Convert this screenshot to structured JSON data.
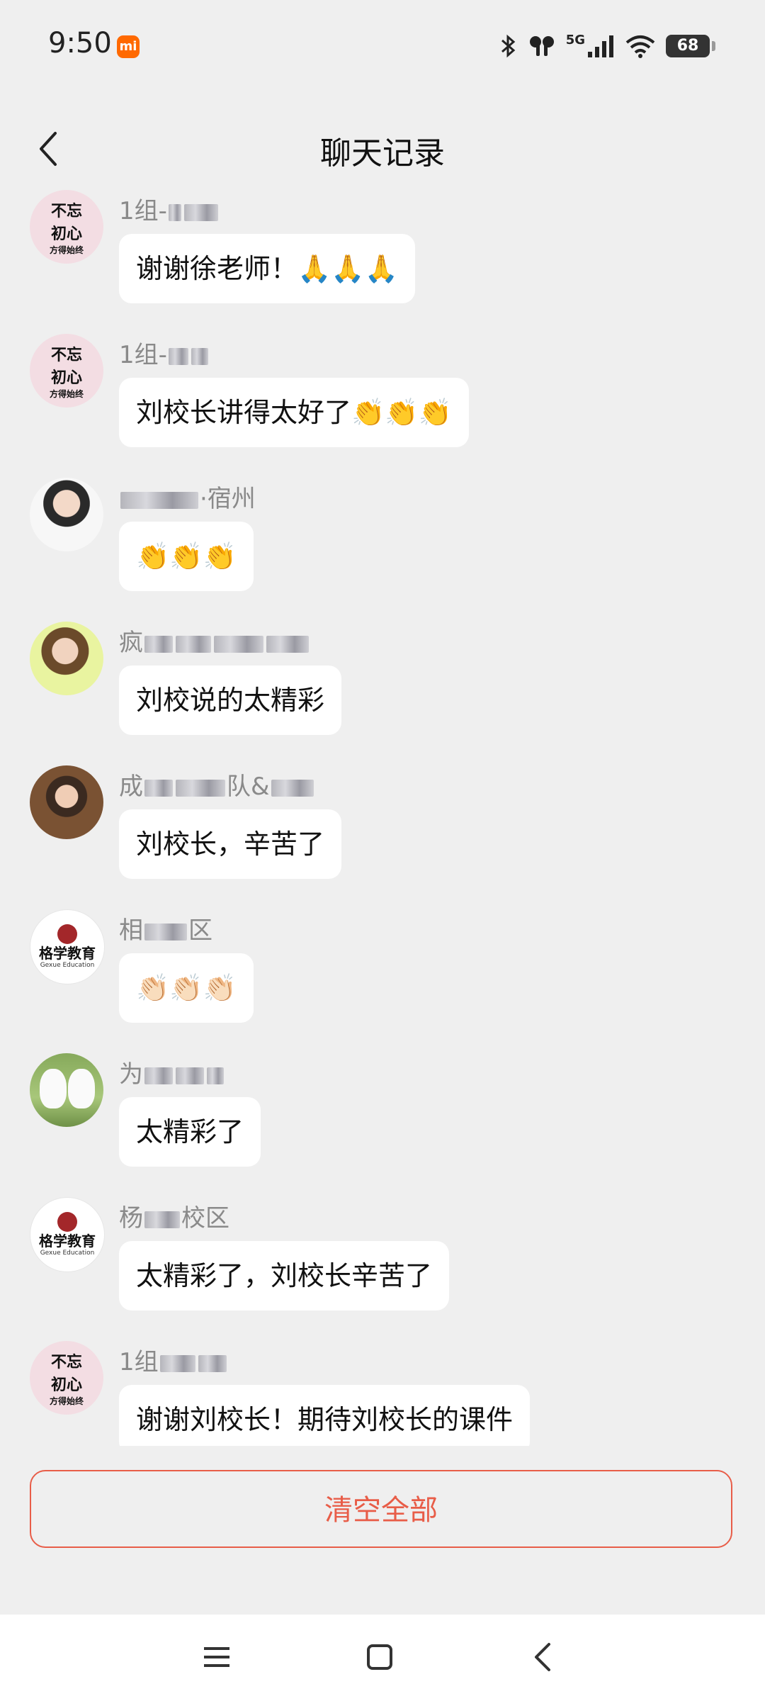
{
  "status_bar": {
    "time": "9:50",
    "app_badge": "mi",
    "network": "5G",
    "battery": "68",
    "icons": [
      "bluetooth-icon",
      "earbuds-icon",
      "signal-icon",
      "wifi-icon",
      "battery-icon"
    ]
  },
  "header": {
    "title": "聊天记录",
    "back_icon": "chevron-left-icon"
  },
  "messages": [
    {
      "sender_prefix": "1组-",
      "sender_suffix": "",
      "text": "谢谢徐老师！🙏🙏🙏"
    },
    {
      "sender_prefix": "1组-",
      "sender_suffix": "",
      "text": "刘校长讲得太好了👏👏👏"
    },
    {
      "sender_prefix": "",
      "sender_suffix": "·宿州",
      "text": "👏👏👏"
    },
    {
      "sender_prefix": "疯",
      "sender_suffix": "",
      "text": "刘校说的太精彩"
    },
    {
      "sender_prefix": "成",
      "sender_suffix": "队&",
      "text": "刘校长，辛苦了"
    },
    {
      "sender_prefix": "相",
      "sender_suffix": "区",
      "text": "👏🏻👏🏻👏🏻"
    },
    {
      "sender_prefix": "为",
      "sender_suffix": "",
      "text": "太精彩了"
    },
    {
      "sender_prefix": "杨",
      "sender_suffix": "校区",
      "text": "太精彩了，刘校长辛苦了"
    },
    {
      "sender_prefix": "1组",
      "sender_suffix": "",
      "text": "谢谢刘校长！期待刘校长的课件"
    }
  ],
  "avatar_texts": {
    "calligraphy_line1": "不忘",
    "calligraphy_line2": "初心",
    "calligraphy_side": "方得始终",
    "gexue_cn": "格学教育",
    "gexue_en": "Gexue Education"
  },
  "actions": {
    "clear_all": "清空全部"
  },
  "colors": {
    "accent": "#e85d48",
    "background": "#efefef",
    "bubble": "#ffffff",
    "sender": "#8a8a8a"
  }
}
